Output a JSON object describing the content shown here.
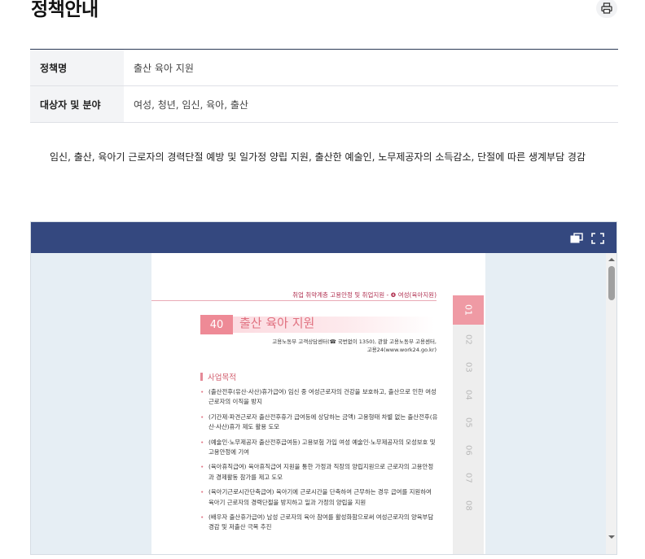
{
  "page": {
    "title": "정책안내"
  },
  "toolbar": {
    "print_icon": "printer-icon"
  },
  "info_table": {
    "rows": [
      {
        "label": "정책명",
        "value": "출산 육아 지원"
      },
      {
        "label": "대상자 및 분야",
        "value": "여성, 청년, 임신, 육아, 출산"
      }
    ]
  },
  "description": "임신, 출산, 육아기 근로자의 경력단절 예방 및 일가정 양립 지원, 출산한 예술인, 노무제공자의 소득감소, 단절에 따른 생계부담 경감",
  "viewer": {
    "restore_icon": "restore-window-icon",
    "fullscreen_icon": "fullscreen-icon",
    "document": {
      "running_head": "취업 취약계층 고용안정 및 취업지원 - ❹ 여성(육아지원)",
      "chapter_number": "40",
      "chapter_title": "출산 육아 지원",
      "contact_line1": "고용노동부 고객상담센터(☎ 국번없이 1350), 관할 고용노동부 고용센터,",
      "contact_line2": "고용24(www.work24.go.kr)",
      "section_heading": "사업목적",
      "bullets": [
        "(출산전후(유산·사산)휴가급여) 임신 중 여성근로자의 건강을 보호하고, 출산으로 인한 여성근로자의 이직을 방지",
        "(기간제·파견근로자 출산전후휴가 급여등에 상당하는 금액) 고용형태 차별 없는 출산전후(유산·사산)휴가 제도 활용 도모",
        "(예술인·노무제공자 출산전후급여등) 고용보험 가입 여성 예술인·노무제공자의 모성보호 및 고용안정에 기여",
        "(육아휴직급여) 육아휴직급여 지원을 통한 가정과 직장의 양립지원으로 근로자의 고용안정과 경제활동 참가를 제고 도모",
        "(육아기근로시간단축급여) 육아기에 근로시간을 단축하여 근무하는 경우 급여를 지원하여 육아기 근로자의 경력단절을 방지하고 일과 가정의 양립을 지원",
        "(배우자 출산휴가급여) 남성 근로자의 육아 참여를 활성화함으로써 여성근로자의 양육부담 경감 및 저출산 극복 추진"
      ],
      "tabs": [
        "01",
        "02",
        "03",
        "04",
        "05",
        "06",
        "07",
        "08"
      ]
    }
  }
}
